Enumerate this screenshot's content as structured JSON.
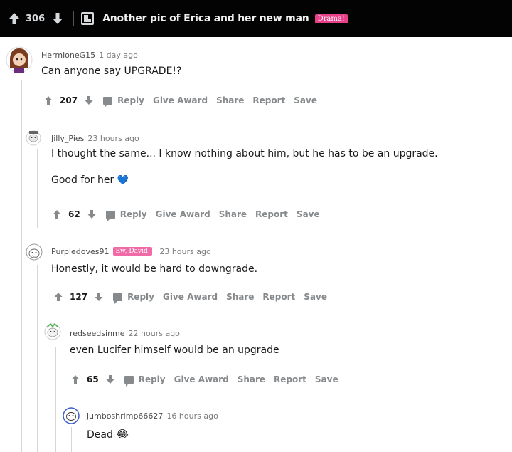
{
  "post": {
    "score": "306",
    "title": "Another pic of Erica and her new man",
    "flair": "Drama!"
  },
  "actions": {
    "reply": "Reply",
    "give_award": "Give Award",
    "share": "Share",
    "report": "Report",
    "save": "Save"
  },
  "comments": [
    {
      "username": "HermioneG15",
      "time": "1 day ago",
      "body": "Can anyone say UPGRADE!?",
      "score": "207"
    },
    {
      "username": "Jilly_Pies",
      "time": "23 hours ago",
      "body": "I thought the same... I know nothing about him, but he has to be an upgrade.",
      "body2": "Good for her",
      "emoji": "💙",
      "score": "62"
    },
    {
      "username": "Purpledoves91",
      "flair": "Ew, David!",
      "time": "23 hours ago",
      "body": "Honestly, it would be hard to downgrade.",
      "score": "127"
    },
    {
      "username": "redseedsinme",
      "time": "22 hours ago",
      "body": "even Lucifer himself would be an upgrade",
      "score": "65"
    },
    {
      "username": "jumboshrimp66627",
      "time": "16 hours ago",
      "body": "Dead",
      "emoji": "😂"
    }
  ]
}
